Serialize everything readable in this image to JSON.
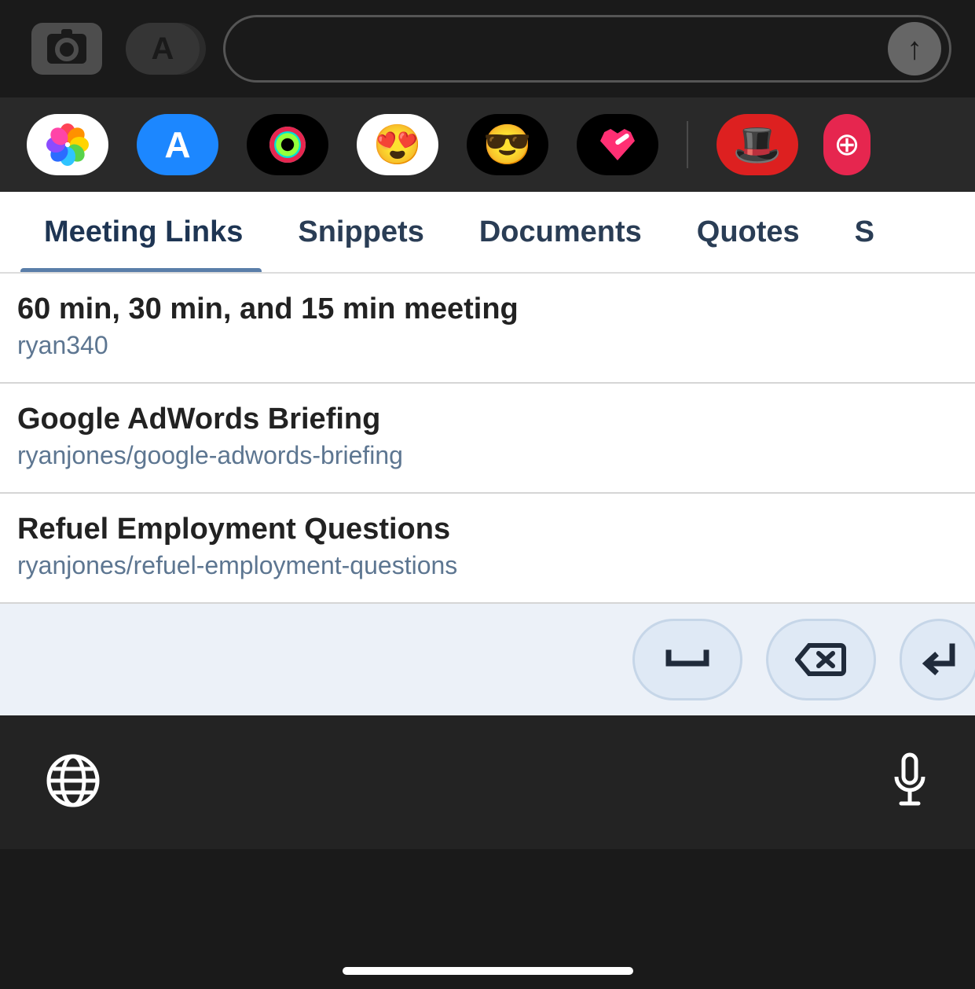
{
  "input": {
    "placeholder": ""
  },
  "app_row": {
    "icons": [
      "photos",
      "appstore",
      "fitness",
      "memoji-hearts",
      "memoji-frame",
      "heart-sticker",
      "monopoly",
      "extra"
    ]
  },
  "tabs": [
    {
      "id": "meeting-links",
      "label": "Meeting Links",
      "active": true
    },
    {
      "id": "snippets",
      "label": "Snippets",
      "active": false
    },
    {
      "id": "documents",
      "label": "Documents",
      "active": false
    },
    {
      "id": "quotes",
      "label": "Quotes",
      "active": false
    },
    {
      "id": "s",
      "label": "S",
      "active": false
    }
  ],
  "items": [
    {
      "title": "60 min, 30 min, and 15 min meeting",
      "sub": "ryan340"
    },
    {
      "title": "Google AdWords Briefing",
      "sub": "ryanjones/google-adwords-briefing"
    },
    {
      "title": "Refuel Employment Questions",
      "sub": "ryanjones/refuel-employment-questions"
    }
  ],
  "actions": {
    "space": "␣",
    "backspace": "⌫",
    "enter": "↵"
  }
}
